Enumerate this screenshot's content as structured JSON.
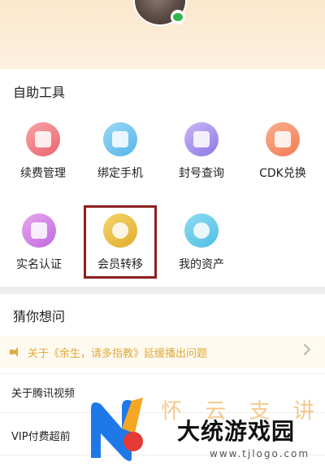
{
  "colors": {
    "header_bg": "#fbe7cc",
    "notice_text": "#e0a93a",
    "highlight_border": "#8b1f1f",
    "wechat_green": "#2fb54a"
  },
  "header": {
    "avatar_icon": "user-avatar",
    "badge_icon": "wechat-icon"
  },
  "tools": {
    "title": "自助工具",
    "items": [
      {
        "label": "续费管理",
        "icon": "renew-icon"
      },
      {
        "label": "绑定手机",
        "icon": "phone-icon"
      },
      {
        "label": "封号查询",
        "icon": "search-doc-icon"
      },
      {
        "label": "CDK兑换",
        "icon": "exchange-icon"
      },
      {
        "label": "实名认证",
        "icon": "id-card-icon"
      },
      {
        "label": "会员转移",
        "icon": "vip-icon"
      },
      {
        "label": "我的资产",
        "icon": "asset-icon"
      }
    ]
  },
  "guess": {
    "title": "猜你想问",
    "notice": "关于《余生，请多指教》延缓播出问题",
    "questions": [
      "关于腾讯视频",
      "VIP付费超前"
    ]
  },
  "watermark": {
    "faint_text": "怀 云 支 讲",
    "site_name": "大统游戏园",
    "url": "www.tjlogo.com"
  }
}
